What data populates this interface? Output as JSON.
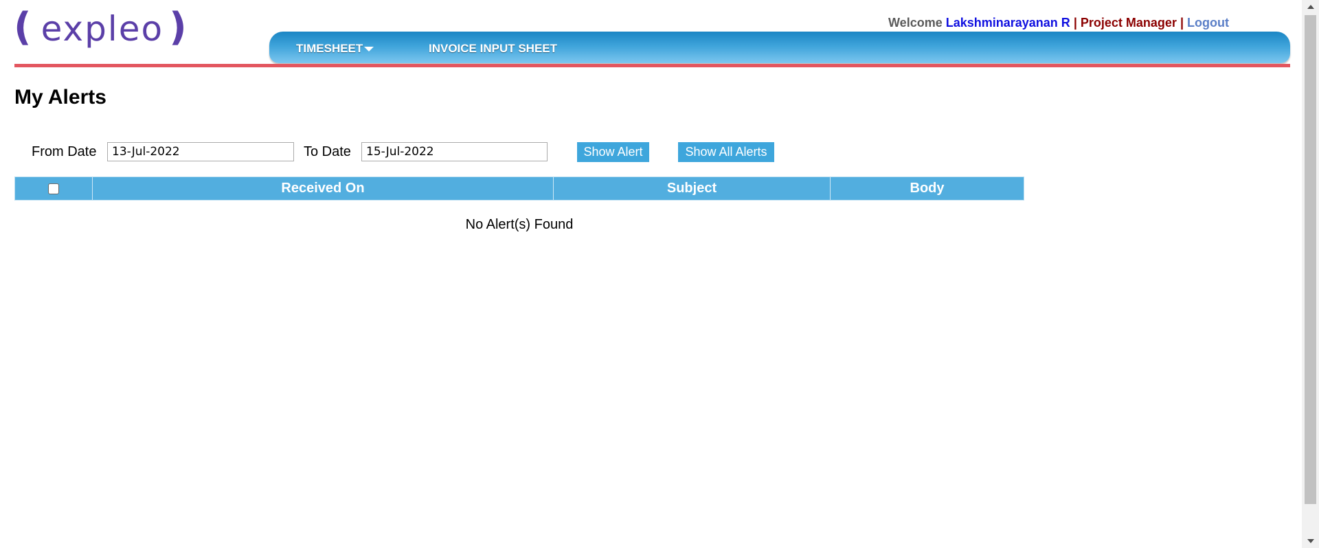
{
  "logo": {
    "left_bracket": "(",
    "text": "expleo",
    "right_bracket": ")"
  },
  "header": {
    "welcome_label": "Welcome",
    "user_name": "Lakshminarayanan R",
    "separator": "|",
    "role": "Project Manager",
    "logout": "Logout"
  },
  "nav": {
    "items": [
      {
        "label": "TIMESHEET",
        "has_dropdown": true
      },
      {
        "label": "INVOICE INPUT SHEET",
        "has_dropdown": false
      }
    ]
  },
  "page": {
    "title": "My Alerts"
  },
  "filters": {
    "from_label": "From Date",
    "from_value": "13-Jul-2022",
    "to_label": "To Date",
    "to_value": "15-Jul-2022",
    "show_alert": "Show Alert",
    "show_all_alerts": "Show All Alerts"
  },
  "table": {
    "columns": [
      "",
      "Received On",
      "Subject",
      "Body"
    ],
    "rows": [],
    "empty_message": "No Alert(s) Found"
  },
  "colors": {
    "logo": "#5b3fa8",
    "nav_top": "#1b86c4",
    "nav_bottom": "#7cc6ef",
    "divider": "#e3565f",
    "table_header": "#52aedf",
    "button": "#3ea6dc",
    "user_name": "#1010e0",
    "role": "#8b0000",
    "logout": "#5a7ec7"
  }
}
